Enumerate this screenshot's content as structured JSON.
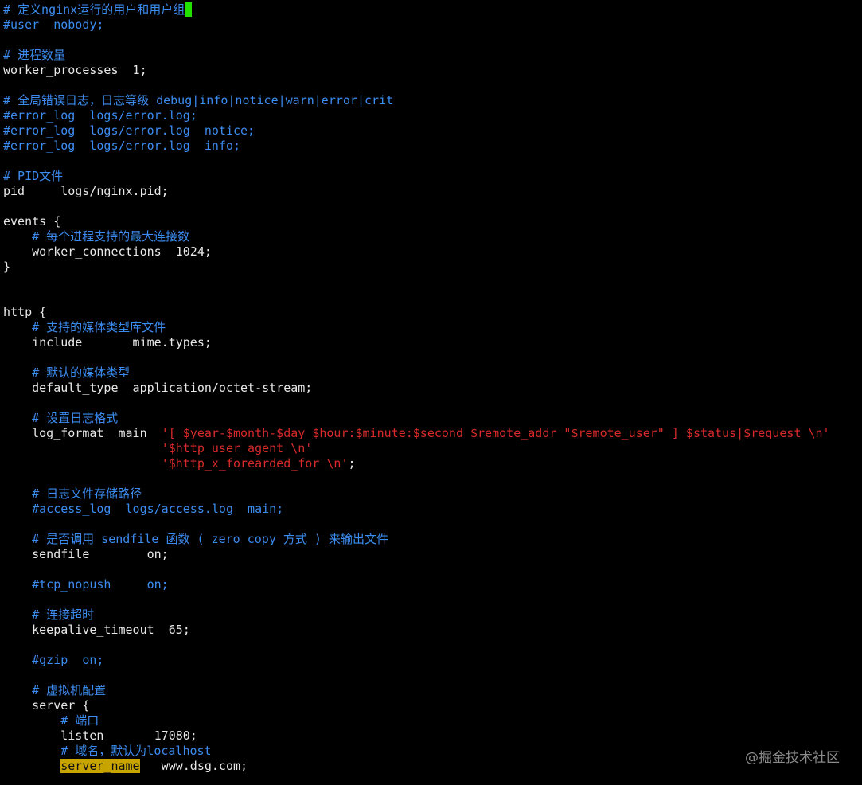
{
  "editor": {
    "cursor_color": "#22e000",
    "colors": {
      "comment": "#3c8cf0",
      "string": "#d72a2a",
      "text": "#e8e8e8",
      "search_highlight": "#c8a400",
      "background": "#000000"
    },
    "lines": [
      [
        {
          "t": "c",
          "v": "# 定义nginx运行的用户和用户组"
        }
      ],
      [
        {
          "t": "c",
          "v": "#user  nobody;"
        }
      ],
      [],
      [
        {
          "t": "c",
          "v": "# 进程数量"
        }
      ],
      [
        {
          "t": "t",
          "v": "worker_processes  1;"
        }
      ],
      [],
      [
        {
          "t": "c",
          "v": "# 全局错误日志，日志等级 debug|info|notice|warn|error|crit"
        }
      ],
      [
        {
          "t": "c",
          "v": "#error_log  logs/error.log;"
        }
      ],
      [
        {
          "t": "c",
          "v": "#error_log  logs/error.log  notice;"
        }
      ],
      [
        {
          "t": "c",
          "v": "#error_log  logs/error.log  info;"
        }
      ],
      [],
      [
        {
          "t": "c",
          "v": "# PID文件"
        }
      ],
      [
        {
          "t": "t",
          "v": "pid     logs/nginx.pid;"
        }
      ],
      [],
      [
        {
          "t": "t",
          "v": "events {"
        }
      ],
      [
        {
          "t": "c",
          "v": "    # 每个进程支持的最大连接数"
        }
      ],
      [
        {
          "t": "t",
          "v": "    worker_connections  1024;"
        }
      ],
      [
        {
          "t": "t",
          "v": "}"
        }
      ],
      [],
      [],
      [
        {
          "t": "t",
          "v": "http {"
        }
      ],
      [
        {
          "t": "c",
          "v": "    # 支持的媒体类型库文件"
        }
      ],
      [
        {
          "t": "t",
          "v": "    include       mime.types;"
        }
      ],
      [],
      [
        {
          "t": "c",
          "v": "    # 默认的媒体类型"
        }
      ],
      [
        {
          "t": "t",
          "v": "    default_type  application/octet-stream;"
        }
      ],
      [],
      [
        {
          "t": "c",
          "v": "    # 设置日志格式"
        }
      ],
      [
        {
          "t": "t",
          "v": "    log_format  main  "
        },
        {
          "t": "s",
          "v": "'[ $year-$month-$day $hour:$minute:$second $remote_addr \"$remote_user\" ] $status|$request \\n'"
        }
      ],
      [
        {
          "t": "t",
          "v": "                      "
        },
        {
          "t": "s",
          "v": "'$http_user_agent \\n'"
        }
      ],
      [
        {
          "t": "t",
          "v": "                      "
        },
        {
          "t": "s",
          "v": "'$http_x_forearded_for \\n'"
        },
        {
          "t": "t",
          "v": ";"
        }
      ],
      [],
      [
        {
          "t": "c",
          "v": "    # 日志文件存储路径"
        }
      ],
      [
        {
          "t": "c",
          "v": "    #access_log  logs/access.log  main;"
        }
      ],
      [],
      [
        {
          "t": "c",
          "v": "    # 是否调用 sendfile 函数 ( zero copy 方式 ) 来输出文件"
        }
      ],
      [
        {
          "t": "t",
          "v": "    sendfile        on;"
        }
      ],
      [],
      [
        {
          "t": "c",
          "v": "    #tcp_nopush     on;"
        }
      ],
      [],
      [
        {
          "t": "c",
          "v": "    # 连接超时"
        }
      ],
      [
        {
          "t": "t",
          "v": "    keepalive_timeout  65;"
        }
      ],
      [],
      [
        {
          "t": "c",
          "v": "    #gzip  on;"
        }
      ],
      [],
      [
        {
          "t": "c",
          "v": "    # 虚拟机配置"
        }
      ],
      [
        {
          "t": "t",
          "v": "    server {"
        }
      ],
      [
        {
          "t": "c",
          "v": "        # 端口"
        }
      ],
      [
        {
          "t": "t",
          "v": "        listen       17080;"
        }
      ],
      [
        {
          "t": "c",
          "v": "        # 域名，默认为localhost"
        }
      ],
      [
        {
          "t": "t",
          "v": "        "
        },
        {
          "t": "hl",
          "v": "server_name"
        },
        {
          "t": "t",
          "v": "   www.dsg.com;"
        }
      ]
    ]
  },
  "watermark": "@掘金技术社区"
}
